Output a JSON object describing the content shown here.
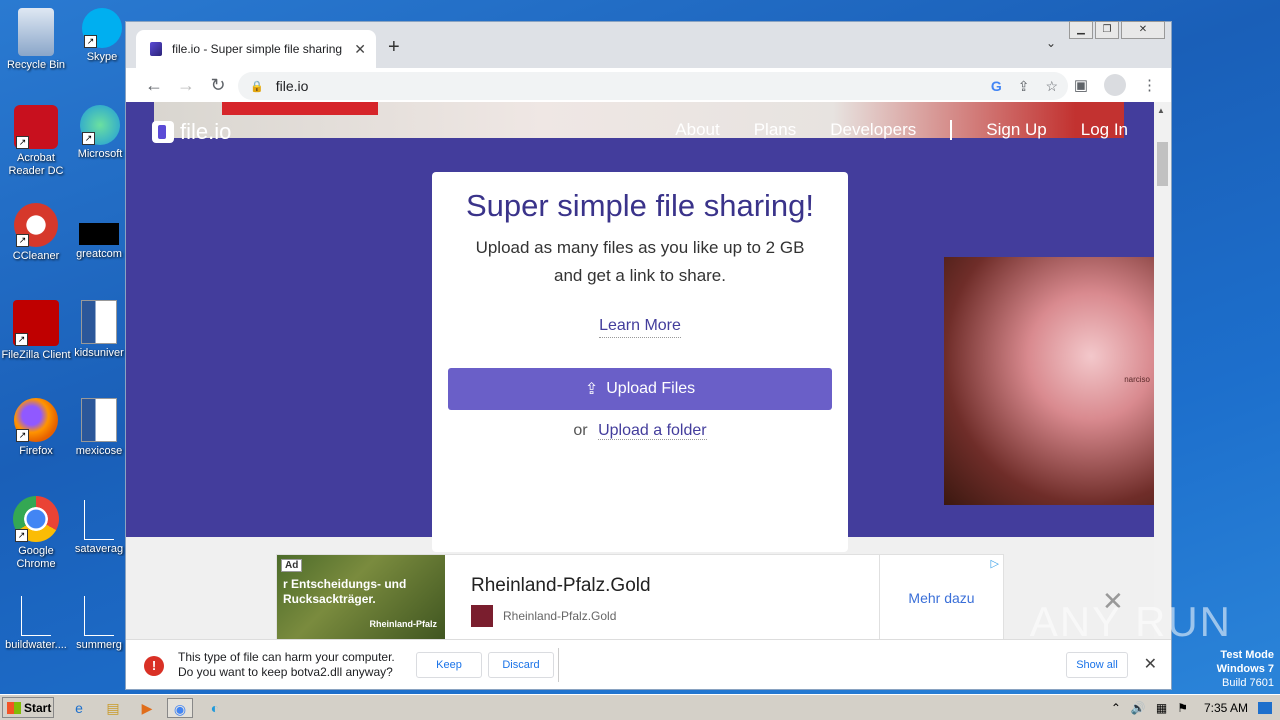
{
  "desktop": {
    "icons": [
      {
        "label": "Recycle Bin",
        "icon": "recycle-bin-icon",
        "color": "#5b8fd6"
      },
      {
        "label": "Skype",
        "icon": "skype-icon",
        "color": "#00aff0"
      },
      {
        "label": "Acrobat Reader DC",
        "icon": "acrobat-icon",
        "color": "#c8101e"
      },
      {
        "label": "Microsoft",
        "icon": "edge-icon",
        "color": "#1f9adb"
      },
      {
        "label": "CCleaner",
        "icon": "ccleaner-icon",
        "color": "#d6382b"
      },
      {
        "label": "greatcom",
        "icon": "black-file-icon",
        "color": "#000000"
      },
      {
        "label": "FileZilla Client",
        "icon": "filezilla-icon",
        "color": "#bf0000"
      },
      {
        "label": "kidsuniver",
        "icon": "word-doc-icon",
        "color": "#2b579a"
      },
      {
        "label": "Firefox",
        "icon": "firefox-icon",
        "color": "#e66000"
      },
      {
        "label": "mexicose",
        "icon": "word-doc-icon",
        "color": "#2b579a"
      },
      {
        "label": "Google Chrome",
        "icon": "chrome-icon",
        "color": "#4285f4"
      },
      {
        "label": "sataverag",
        "icon": "blank-file-icon",
        "color": "#1d6fcc"
      },
      {
        "label": "buildwater....",
        "icon": "blank-file-icon",
        "color": "#1d6fcc"
      },
      {
        "label": "summerg",
        "icon": "blank-file-icon",
        "color": "#1d6fcc"
      }
    ]
  },
  "browser": {
    "tab_title": "file.io - Super simple file sharing",
    "url": "file.io"
  },
  "site": {
    "logo_text": "file.io",
    "nav": {
      "about": "About",
      "plans": "Plans",
      "developers": "Developers",
      "signup": "Sign Up",
      "login": "Log In"
    },
    "hero_title": "Super simple file sharing!",
    "hero_sub1": "Upload as many files as you like up to 2 GB",
    "hero_sub2": "and get a link to share.",
    "learn_more": "Learn More",
    "upload_button": "Upload Files",
    "or": "or",
    "upload_folder": "Upload a folder",
    "side_ad_brand": "narciso",
    "accent": "#433d9c",
    "button_color": "#6a5fc8"
  },
  "ad": {
    "tag": "Ad",
    "image_text": "r Entscheidungs- und Rucksackträger.",
    "image_brand": "Rheinland-Pfalz",
    "title": "Rheinland-Pfalz.Gold",
    "subtitle": "Rheinland-Pfalz.Gold",
    "more": "Mehr dazu"
  },
  "download_bar": {
    "line1": "This type of file can harm your computer.",
    "line2": "Do you want to keep botva2.dll anyway?",
    "keep": "Keep",
    "discard": "Discard",
    "show_all": "Show all"
  },
  "overlay": {
    "watermark": "ANY RUN",
    "test_mode": "Test Mode",
    "os": "Windows 7",
    "build": "Build 7601"
  },
  "taskbar": {
    "start": "Start",
    "clock": "7:35 AM"
  }
}
